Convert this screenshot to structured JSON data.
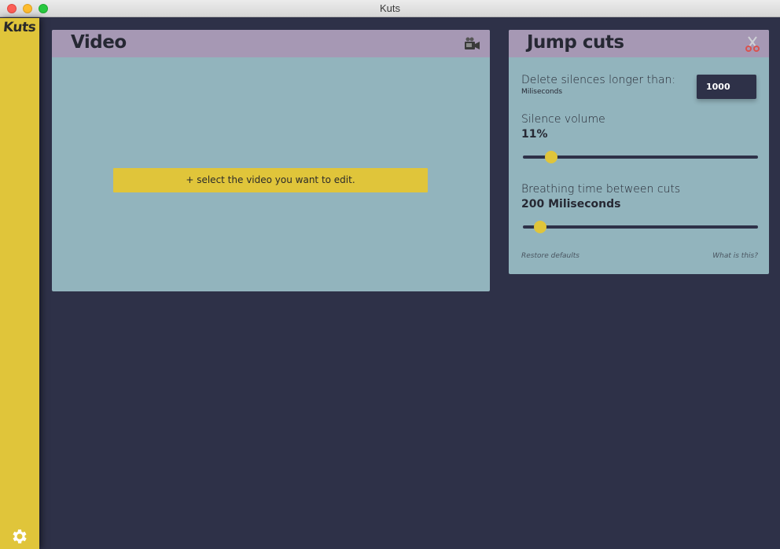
{
  "window": {
    "title": "Kuts"
  },
  "sidebar": {
    "logo": "Kuts",
    "settings_icon": "gear-icon"
  },
  "video": {
    "title": "Video",
    "icon": "video-camera-icon",
    "select_button_label": "+ select the video you want to edit."
  },
  "jump_cuts": {
    "title": "Jump cuts",
    "icon": "scissors-icon",
    "delete_silences_label": "Delete silences longer than:",
    "delete_silences_unit": "Miliseconds",
    "delete_silences_value": "1000",
    "silence_volume_label": "Silence volume",
    "silence_volume_value": "11%",
    "silence_volume_fraction": 0.12,
    "breathing_label": "Breathing time between cuts",
    "breathing_value": "200 Miliseconds",
    "breathing_fraction": 0.075,
    "restore_defaults": "Restore defaults",
    "what_is_this": "What is this?"
  },
  "colors": {
    "background": "#2e3148",
    "accent": "#e0c53a",
    "card": "#92b4bd",
    "card_header": "#a698b4"
  }
}
